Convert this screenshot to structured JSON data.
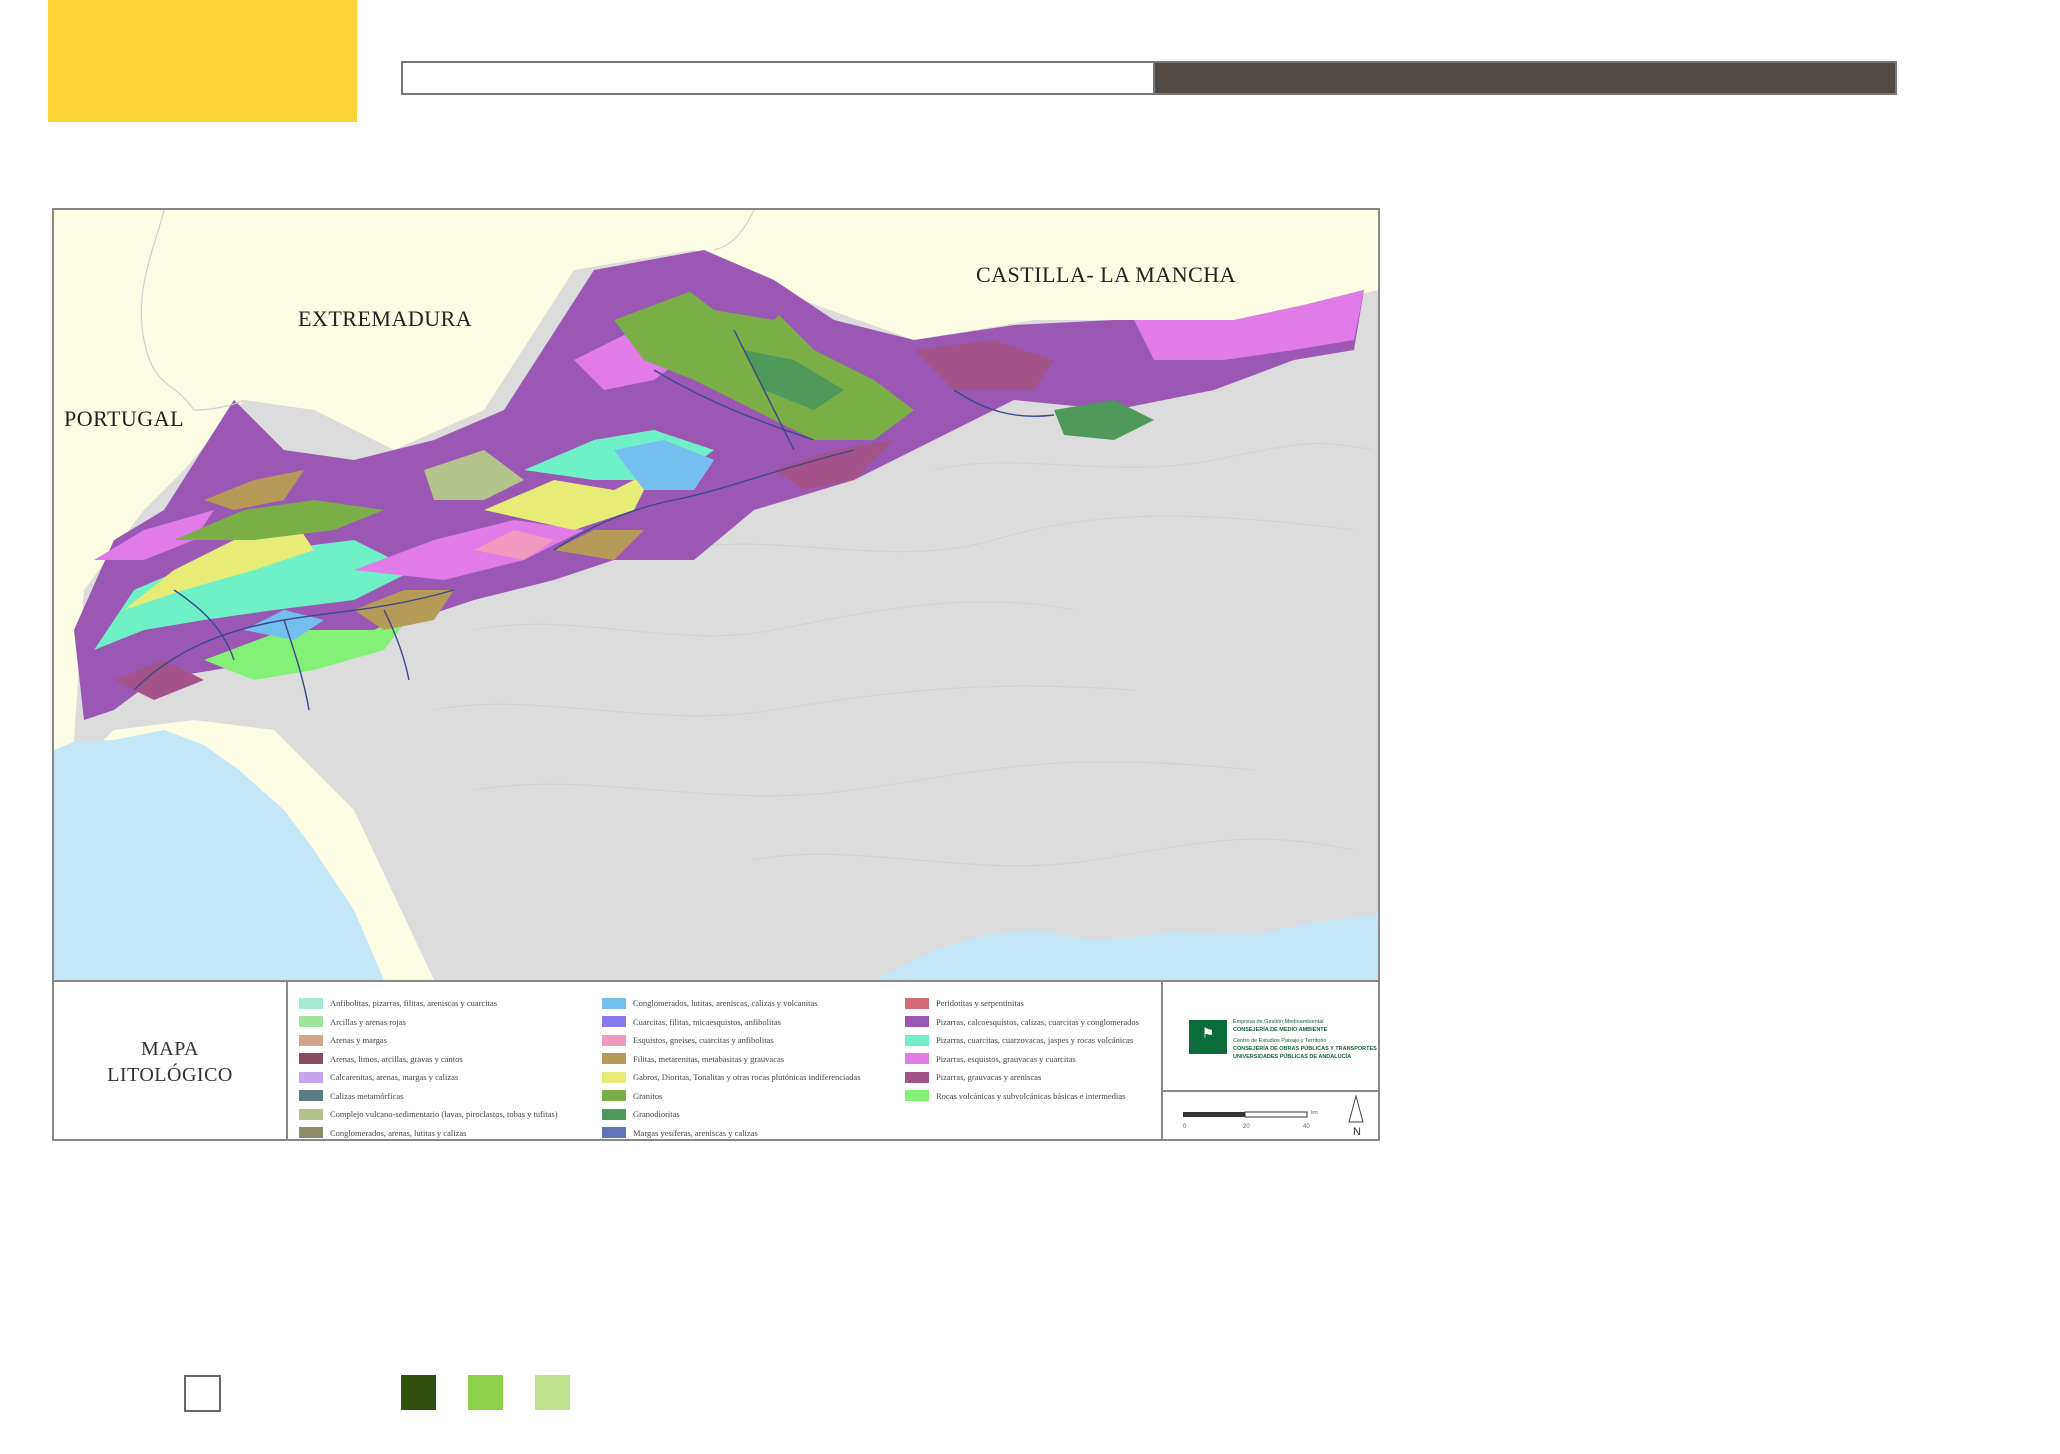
{
  "header": {
    "accent_color": "#fdd335",
    "bar_dark_color": "#524b45"
  },
  "map": {
    "labels": {
      "castilla": "CASTILLA- LA MANCHA",
      "extremadura": "EXTREMADURA",
      "portugal": "PORTUGAL"
    },
    "colors": {
      "land_outside": "#fdfde4",
      "sea": "#c3e6f8",
      "relief": "#dcdcdc",
      "rivers": "#3a4a8a"
    }
  },
  "legend": {
    "title_line1": "MAPA",
    "title_line2": "LITOLÓGICO",
    "columns": [
      [
        {
          "label": "Anfibolitas, pizarras, filitas, areniscas y cuarcitas",
          "color": "#a6ead6"
        },
        {
          "label": "Arcillas y arenas rojas",
          "color": "#9ee59e"
        },
        {
          "label": "Arenas y margas",
          "color": "#d4a48a"
        },
        {
          "label": "Arenas, limos, arcillas, gravas y cantos",
          "color": "#8a4a62"
        },
        {
          "label": "Calcarenitas, arenas, margas y calizas",
          "color": "#c7a3ef"
        },
        {
          "label": "Calizas metamórficas",
          "color": "#5b7b86"
        },
        {
          "label": "Complejo vulcano-sedimentario (lavas, piroclastos, tobas y tufitas)",
          "color": "#b3c38b"
        },
        {
          "label": "Conglomerados, arenas, lutitas y calizas",
          "color": "#8f8a6a"
        }
      ],
      [
        {
          "label": "Conglomerados, lutitas, areniscas, calizas y volcanitas",
          "color": "#75bff0"
        },
        {
          "label": "Cuarcitas, filitas, micaesquistos, anfibolitas",
          "color": "#8a79ee"
        },
        {
          "label": "Esquistos, gneises, cuarcitas y anfibolitas",
          "color": "#f19ac0"
        },
        {
          "label": "Filitas, metarenitas, metabasitas y grauvacas",
          "color": "#b59a58"
        },
        {
          "label": "Gabros, Dioritas, Tonalitas y otras rocas plutónicas indiferenciadas",
          "color": "#e6ec76"
        },
        {
          "label": "Granitos",
          "color": "#7aae46"
        },
        {
          "label": "Granodioritas",
          "color": "#4f9a5b"
        },
        {
          "label": "Margas yesíferas, areniscas y calizas",
          "color": "#5e73b8"
        }
      ],
      [
        {
          "label": "Peridotitas y serpentinitas",
          "color": "#d66b78"
        },
        {
          "label": "Pizarras, calcoesquistos, calizas, cuarcitas y conglomerados",
          "color": "#9a58b4"
        },
        {
          "label": "Pizarras, cuarcitas, cuarzovacas, jaspes y rocas volcánicas",
          "color": "#6ff0c6"
        },
        {
          "label": "Pizarras, esquistos, grauvacas y cuarcitas",
          "color": "#e07be8"
        },
        {
          "label": "Pizarras, grauvacas y areniscas",
          "color": "#a4528a"
        },
        {
          "label": "Rocas volcánicas y subvolcánicas básicas e intermedias",
          "color": "#85f078"
        }
      ]
    ]
  },
  "institution": {
    "line1": "Empresa de Gestión Medioambiental",
    "line2": "CONSEJERÍA DE MEDIO AMBIENTE",
    "line3": "Centro de Estudios Paisaje y Territorio",
    "line4": "CONSEJERÍA DE OBRAS PÚBLICAS Y TRANSPORTES",
    "line5": "UNIVERSIDADES PÚBLICAS DE ANDALUCÍA",
    "emblem_color": "#0b6b3a"
  },
  "scale": {
    "tick_0": "0",
    "tick_20": "20",
    "tick_40": "40",
    "unit": "km",
    "north": "N"
  },
  "bottom_squares": {
    "outline_color": "#ffffff",
    "colors": [
      "#2f4f0f",
      "#8fd04a",
      "#bde38f"
    ]
  }
}
